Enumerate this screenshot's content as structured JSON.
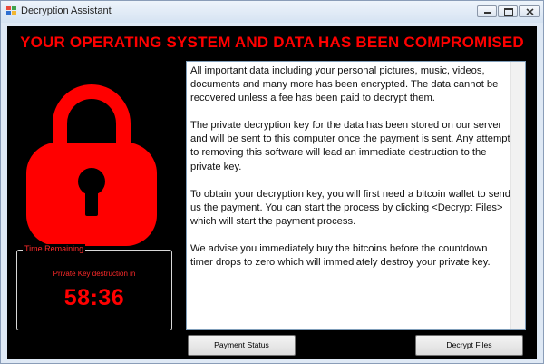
{
  "window": {
    "title": "Decryption Assistant"
  },
  "headline": "YOUR OPERATING SYSTEM AND DATA HAS BEEN COMPROMISED",
  "timer": {
    "legend": "Time Remaining",
    "caption": "Private Key destruction in",
    "value": "58:36"
  },
  "message": {
    "paragraphs": [
      "All important data including your personal pictures, music, videos, documents and many more has been encrypted. The data cannot be recovered unless a fee has been paid to decrypt them.",
      "The private decryption key for the data has been stored on our server and will be sent to this computer once the payment is sent. Any attempt to removing this software will lead an immediate destruction to the private key.",
      "To obtain your decryption key, you will first need a bitcoin wallet to send us the payment. You can start the process by clicking <Decrypt Files> which will start the payment process.",
      "We advise you immediately buy the bitcoins before the countdown timer drops to zero which will immediately destroy your private key."
    ]
  },
  "buttons": {
    "payment_status": "Payment Status",
    "decrypt_files": "Decrypt Files"
  },
  "colors": {
    "accent_red": "#ff0000",
    "background": "#000000"
  },
  "icons": [
    "app-icon",
    "minimize-icon",
    "maximize-icon",
    "close-icon",
    "padlock-icon"
  ]
}
